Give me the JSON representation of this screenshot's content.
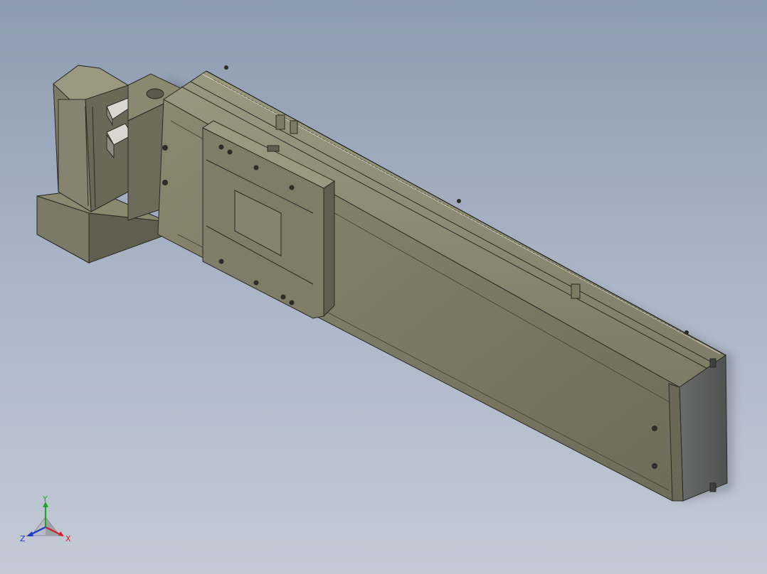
{
  "viewport": {
    "background_top": "#8d9bb0",
    "background_bottom": "#c4cad6"
  },
  "model": {
    "body_color": "#7b7a66",
    "body_light": "#8a896f",
    "body_dark": "#5f5e4f",
    "end_cap_color": "#5b5c5c",
    "edge_color": "#2a2a24"
  },
  "triad": {
    "x_label": "X",
    "y_label": "Y",
    "z_label": "Z",
    "x_color": "#d0202a",
    "y_color": "#1fa52a",
    "z_color": "#1f3ad0"
  }
}
